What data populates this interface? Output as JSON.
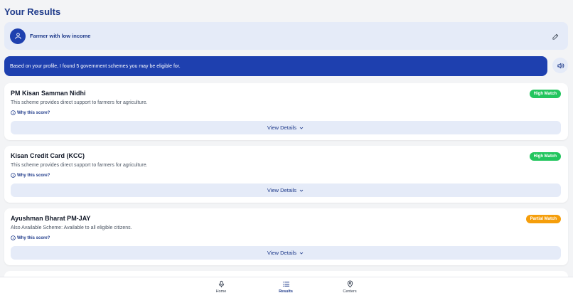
{
  "page": {
    "title": "Your Results"
  },
  "profile": {
    "label": "Farmer with low income"
  },
  "banner": {
    "message": "Based on your profile, I found 5 government schemes you may be eligible for."
  },
  "colors": {
    "primary": "#1e40af",
    "high_match": "#22c55e",
    "partial_match": "#f59e0b"
  },
  "schemes": [
    {
      "name": "PM Kisan Samman Nidhi",
      "description": "This scheme provides direct support to farmers for agriculture.",
      "why_label": "Why this score?",
      "badge": "High Match",
      "badge_type": "high",
      "details_label": "View Details"
    },
    {
      "name": "Kisan Credit Card (KCC)",
      "description": "This scheme provides direct support to farmers for agriculture.",
      "why_label": "Why this score?",
      "badge": "High Match",
      "badge_type": "high",
      "details_label": "View Details"
    },
    {
      "name": "Ayushman Bharat PM-JAY",
      "description": "Also Available Scheme: Available to all eligible citizens.",
      "why_label": "Why this score?",
      "badge": "Partial Match",
      "badge_type": "partial",
      "details_label": "View Details"
    }
  ],
  "nav": {
    "items": [
      {
        "label": "Home",
        "icon": "mic-icon",
        "active": false
      },
      {
        "label": "Results",
        "icon": "list-icon",
        "active": true
      },
      {
        "label": "Centers",
        "icon": "map-pin-icon",
        "active": false
      }
    ]
  }
}
